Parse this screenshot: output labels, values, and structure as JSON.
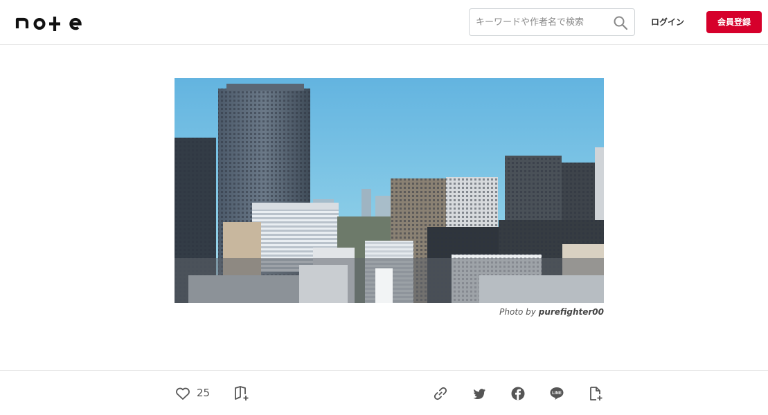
{
  "header": {
    "logo_text": "note",
    "search_placeholder": "キーワードや作者名で検索",
    "login_label": "ログイン",
    "signup_label": "会員登録",
    "signup_color": "#d6002b"
  },
  "hero": {
    "caption_prefix": "Photo by",
    "caption_author": "purefighter00"
  },
  "footer": {
    "like_count": "25",
    "icons": [
      "heart-icon",
      "magazine-add-icon",
      "link-icon",
      "twitter-icon",
      "facebook-icon",
      "line-icon",
      "embed-icon"
    ]
  }
}
